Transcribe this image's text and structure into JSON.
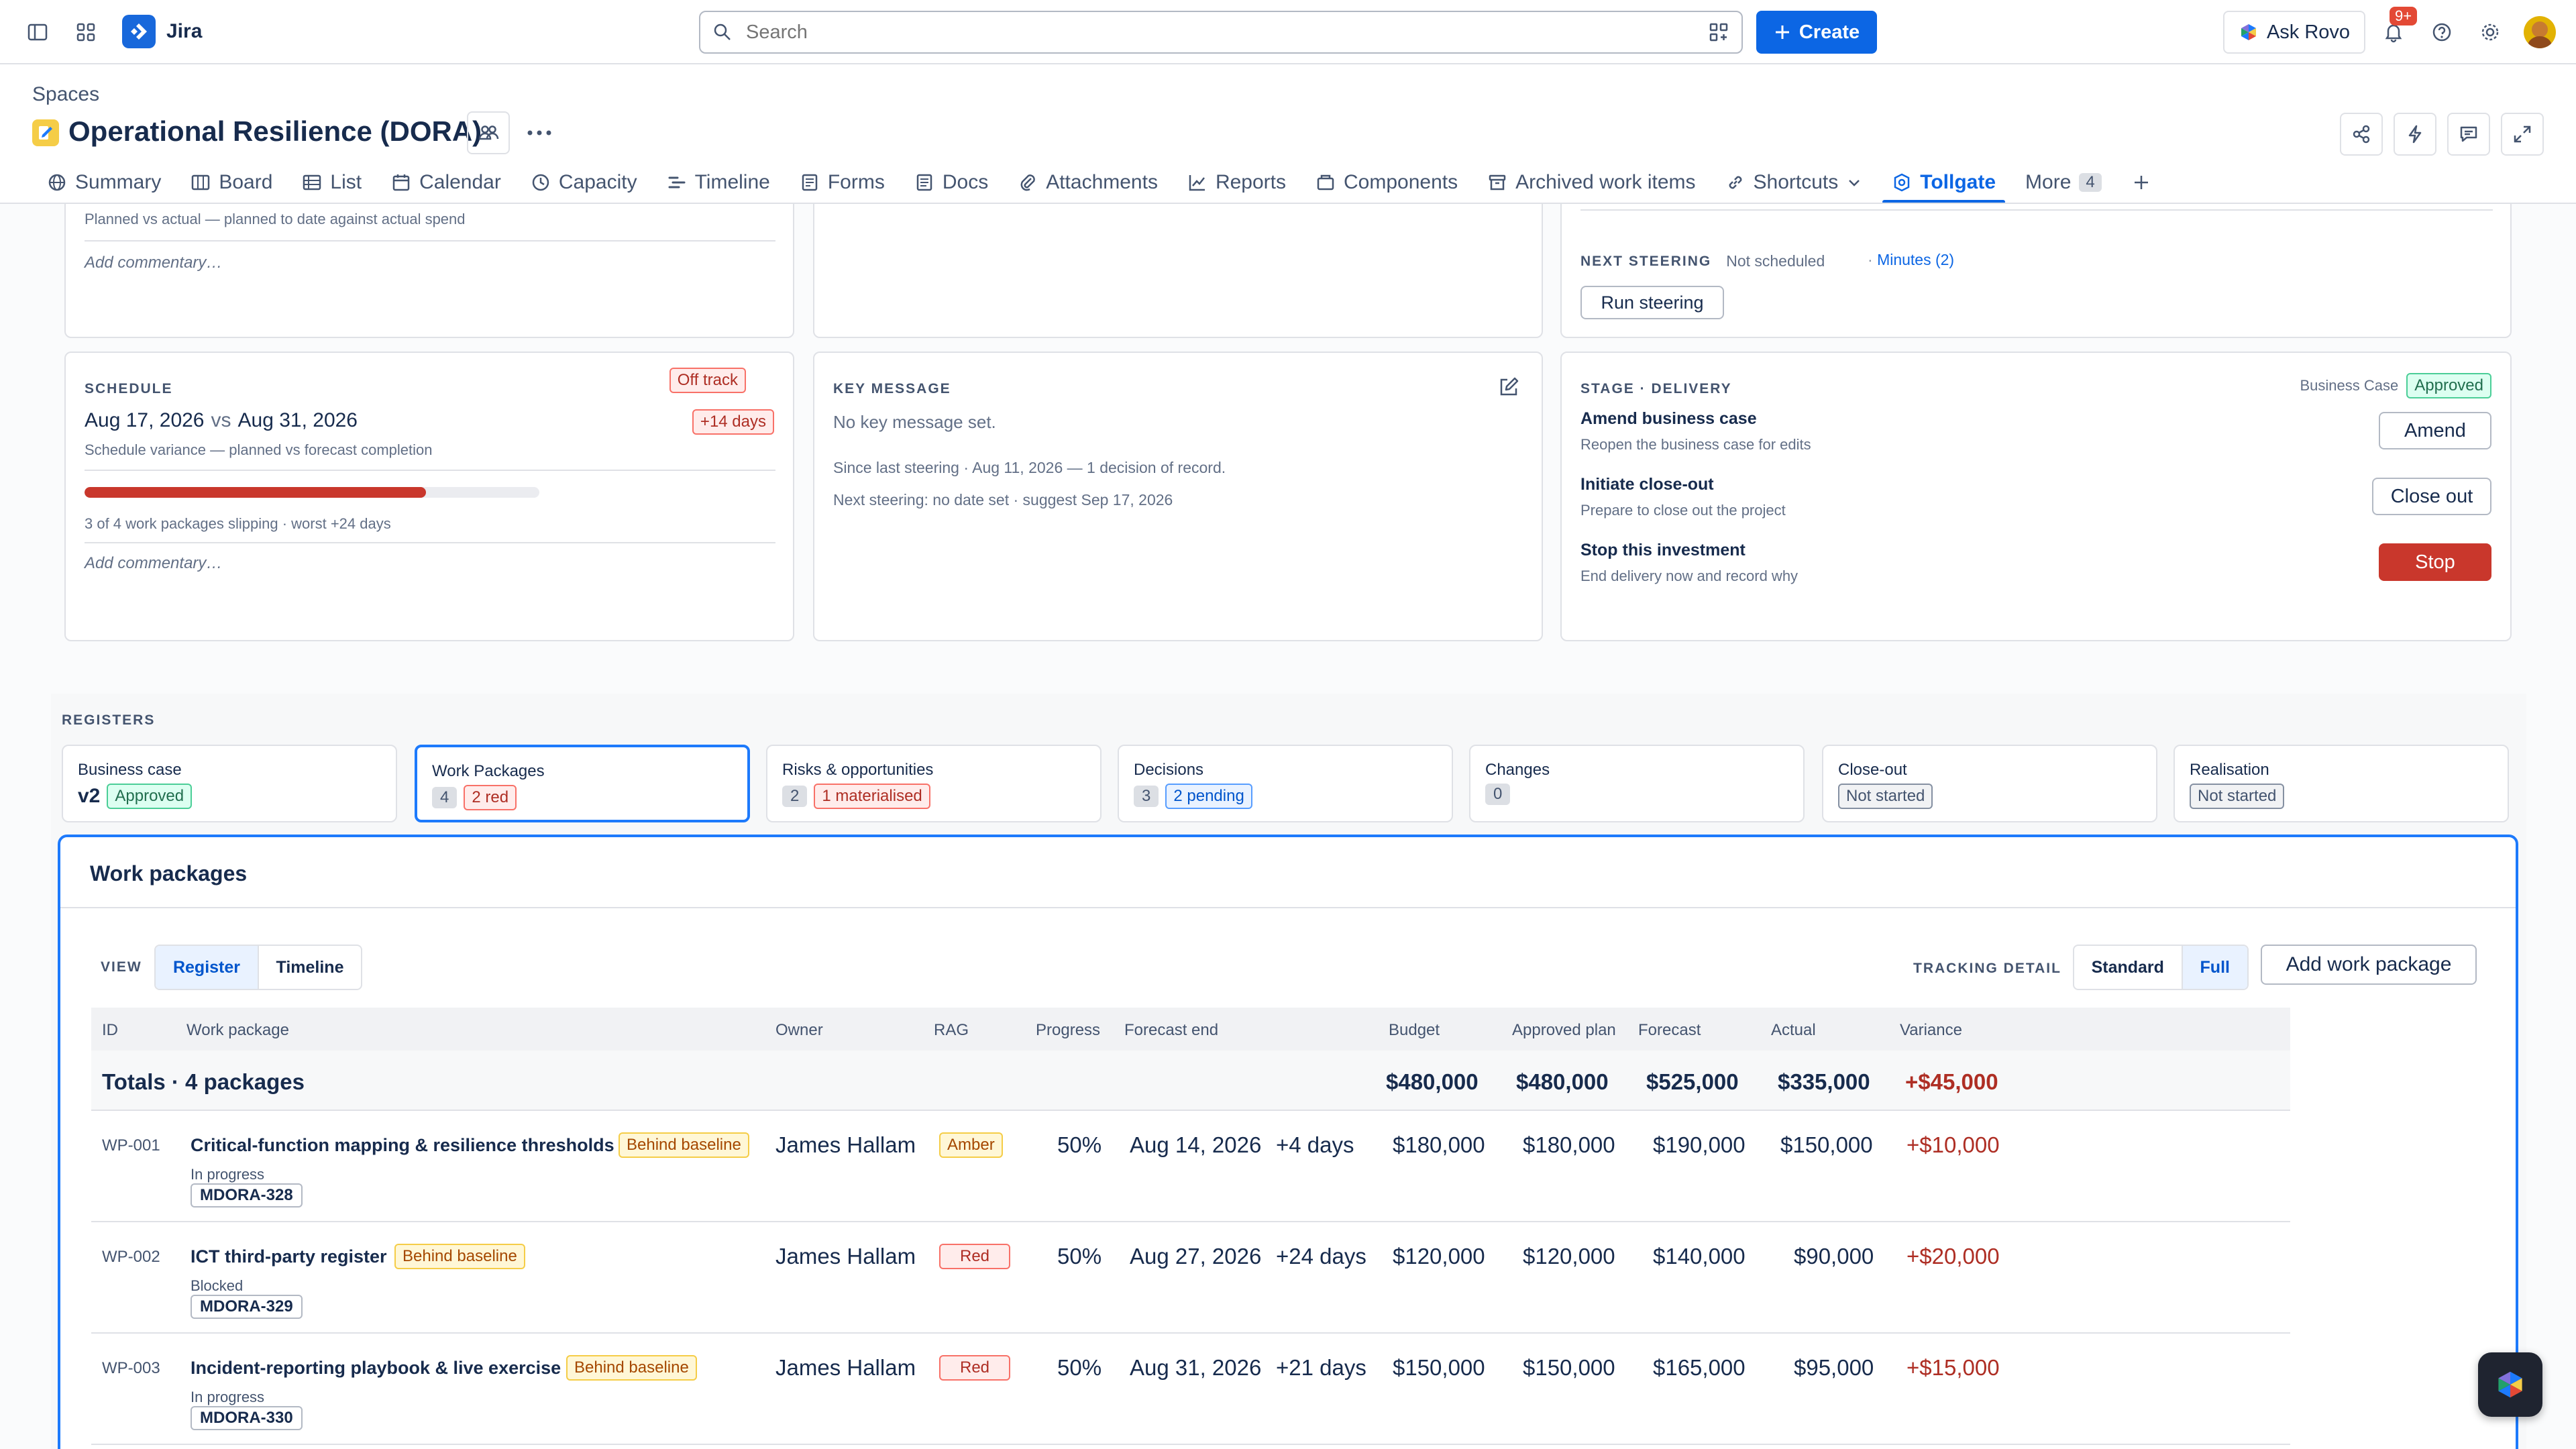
{
  "topbar": {
    "app_name": "Jira",
    "search_placeholder": "Search",
    "create_label": "Create",
    "rovo_label": "Ask Rovo",
    "notification_count": "9+"
  },
  "header": {
    "breadcrumb": "Spaces",
    "title": "Operational Resilience (DORA)"
  },
  "tabs": [
    {
      "label": "Summary",
      "icon": "globe-icon"
    },
    {
      "label": "Board",
      "icon": "board-icon"
    },
    {
      "label": "List",
      "icon": "list-icon"
    },
    {
      "label": "Calendar",
      "icon": "calendar-icon"
    },
    {
      "label": "Capacity",
      "icon": "clock-icon"
    },
    {
      "label": "Timeline",
      "icon": "timeline-icon"
    },
    {
      "label": "Forms",
      "icon": "forms-icon"
    },
    {
      "label": "Docs",
      "icon": "docs-icon"
    },
    {
      "label": "Attachments",
      "icon": "paperclip-icon"
    },
    {
      "label": "Reports",
      "icon": "chart-icon"
    },
    {
      "label": "Components",
      "icon": "components-icon"
    },
    {
      "label": "Archived work items",
      "icon": "archive-icon"
    },
    {
      "label": "Shortcuts",
      "icon": "link-icon"
    },
    {
      "label": "Tollgate",
      "icon": "tollgate-icon"
    },
    {
      "label": "More",
      "icon": "",
      "count": "4"
    }
  ],
  "budget_card": {
    "subtitle": "Planned vs actual — planned to date against actual spend",
    "commentary_placeholder": "Add commentary…"
  },
  "schedule_card": {
    "caption": "SCHEDULE",
    "status": "Off track",
    "date_from": "Aug 17, 2026",
    "vs": "vs",
    "date_to": "Aug 31, 2026",
    "variance": "+14 days",
    "subtitle": "Schedule variance — planned vs forecast completion",
    "progress": 0.75,
    "slipping": "3 of 4 work packages slipping · worst +24 days",
    "commentary_placeholder": "Add commentary…"
  },
  "key_message_card": {
    "caption": "KEY MESSAGE",
    "message": "No key message set.",
    "since": "Since last steering · Aug 11, 2026 — 1 decision of record.",
    "next": "Next steering: no date set · suggest Sep 17, 2026"
  },
  "steering": {
    "caption": "NEXT STEERING",
    "status": "Not scheduled",
    "minutes": "Minutes (2)",
    "run_label": "Run steering"
  },
  "stage_card": {
    "caption": "STAGE · DELIVERY",
    "bc_label": "Business Case",
    "bc_status": "Approved",
    "actions": [
      {
        "title": "Amend business case",
        "desc": "Reopen the business case for edits",
        "button": "Amend"
      },
      {
        "title": "Initiate close-out",
        "desc": "Prepare to close out the project",
        "button": "Close out"
      },
      {
        "title": "Stop this investment",
        "desc": "End delivery now and record why",
        "button": "Stop"
      }
    ]
  },
  "registers": {
    "caption": "REGISTERS",
    "tiles": [
      {
        "label": "Business case",
        "value": "v2",
        "badge": "Approved"
      },
      {
        "label": "Work Packages",
        "value": "4",
        "badge": "2 red"
      },
      {
        "label": "Risks & opportunities",
        "value": "2",
        "badge": "1 materialised"
      },
      {
        "label": "Decisions",
        "value": "3",
        "badge": "2 pending"
      },
      {
        "label": "Changes",
        "value": "0",
        "badge": ""
      },
      {
        "label": "Close-out",
        "value": "",
        "badge": "Not started"
      },
      {
        "label": "Realisation",
        "value": "",
        "badge": "Not started"
      }
    ]
  },
  "work_packages": {
    "title": "Work packages",
    "view_caption": "VIEW",
    "view_options": [
      "Register",
      "Timeline"
    ],
    "tracking_caption": "TRACKING DETAIL",
    "tracking_options": [
      "Standard",
      "Full"
    ],
    "add_label": "Add work package",
    "columns": [
      "ID",
      "Work package",
      "Owner",
      "RAG",
      "Progress",
      "Forecast end",
      "Budget",
      "Approved plan",
      "Forecast",
      "Actual",
      "Variance"
    ],
    "totals": {
      "label": "Totals · 4 packages",
      "budget": "$480,000",
      "approved": "$480,000",
      "forecast": "$525,000",
      "actual": "$335,000",
      "variance": "+$45,000"
    },
    "rows": [
      {
        "id": "WP-001",
        "name": "Critical-function mapping & resilience thresholds",
        "flag": "Behind baseline",
        "status": "In progress",
        "key": "MDORA-328",
        "owner": "James Hallam",
        "rag": "Amber",
        "progress": "50%",
        "forecast_end": "Aug 14, 2026",
        "delta": "+4 days",
        "budget": "$180,000",
        "approved": "$180,000",
        "forecast": "$190,000",
        "actual": "$150,000",
        "variance": "+$10,000"
      },
      {
        "id": "WP-002",
        "name": "ICT third-party register",
        "flag": "Behind baseline",
        "status": "Blocked",
        "key": "MDORA-329",
        "owner": "James Hallam",
        "rag": "Red",
        "progress": "50%",
        "forecast_end": "Aug 27, 2026",
        "delta": "+24 days",
        "budget": "$120,000",
        "approved": "$120,000",
        "forecast": "$140,000",
        "actual": "$90,000",
        "variance": "+$20,000"
      },
      {
        "id": "WP-003",
        "name": "Incident-reporting playbook & live exercise",
        "flag": "Behind baseline",
        "status": "In progress",
        "key": "MDORA-330",
        "owner": "James Hallam",
        "rag": "Red",
        "progress": "50%",
        "forecast_end": "Aug 31, 2026",
        "delta": "+21 days",
        "budget": "$150,000",
        "approved": "$150,000",
        "forecast": "$165,000",
        "actual": "$95,000",
        "variance": "+$15,000"
      }
    ]
  }
}
